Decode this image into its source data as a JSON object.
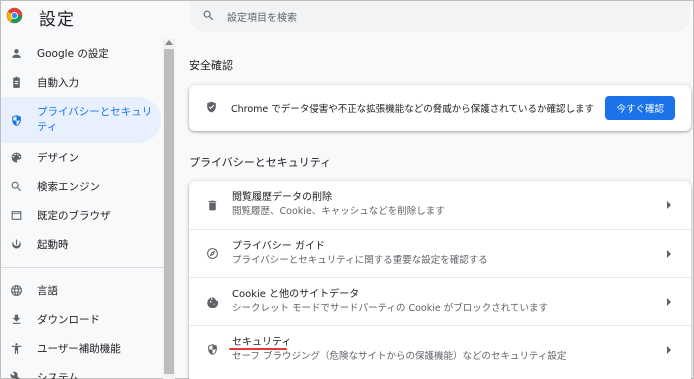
{
  "header": {
    "title": "設定",
    "search_placeholder": "設定項目を検索"
  },
  "sidebar": {
    "items": [
      {
        "label": "Google の設定",
        "icon": "person-icon"
      },
      {
        "label": "自動入力",
        "icon": "clipboard-icon"
      },
      {
        "label": "プライバシーとセキュリティ",
        "icon": "shield-icon",
        "active": true
      },
      {
        "label": "デザイン",
        "icon": "palette-icon"
      },
      {
        "label": "検索エンジン",
        "icon": "search-icon"
      },
      {
        "label": "既定のブラウザ",
        "icon": "browser-icon"
      },
      {
        "label": "起動時",
        "icon": "power-icon"
      },
      {
        "label": "言語",
        "icon": "globe-icon"
      },
      {
        "label": "ダウンロード",
        "icon": "download-icon"
      },
      {
        "label": "ユーザー補助機能",
        "icon": "accessibility-icon"
      },
      {
        "label": "システム",
        "icon": "wrench-icon"
      }
    ]
  },
  "safety": {
    "section_title": "安全確認",
    "message": "Chrome でデータ侵害や不正な拡張機能などの脅威から保護されているか確認します",
    "button": "今すぐ確認"
  },
  "privacy": {
    "section_title": "プライバシーとセキュリティ",
    "rows": [
      {
        "title": "閲覧履歴データの削除",
        "subtitle": "閲覧履歴、Cookie、キャッシュなどを削除します",
        "icon": "trash-icon"
      },
      {
        "title": "プライバシー ガイド",
        "subtitle": "プライバシーとセキュリティに関する重要な設定を確認する",
        "icon": "compass-icon"
      },
      {
        "title": "Cookie と他のサイトデータ",
        "subtitle": "シークレット モードでサードパーティの Cookie がブロックされています",
        "icon": "cookie-icon"
      },
      {
        "title": "セキュリティ",
        "subtitle": "セーフ ブラウジング（危険なサイトからの保護機能）などのセキュリティ設定",
        "icon": "shield-icon"
      }
    ]
  },
  "colors": {
    "accent": "#1a73e8",
    "active_bg": "#e8f0fe",
    "highlight_underline": "#e53935"
  }
}
